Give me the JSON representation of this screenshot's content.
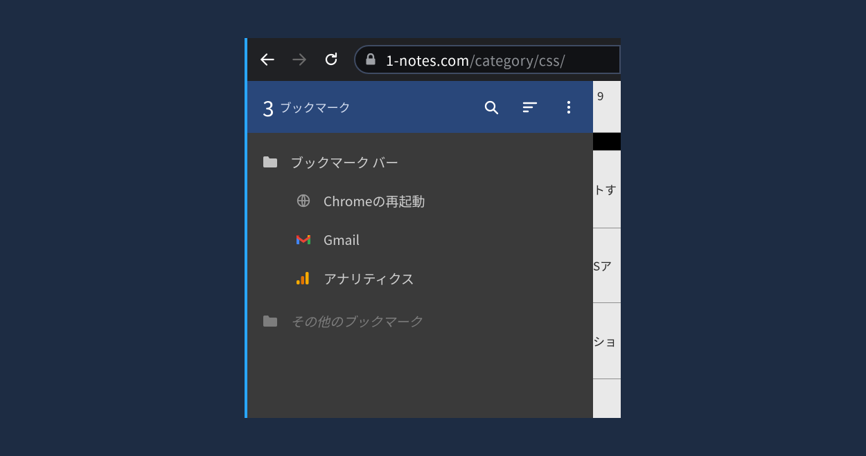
{
  "browser": {
    "url_host": "1-notes.com",
    "url_path": "/category/css/"
  },
  "bookmarkHeader": {
    "count": "3",
    "title": "ブックマーク"
  },
  "bookmarks": {
    "bar_label": "ブックマーク バー",
    "items": [
      {
        "label": "Chromeの再起動",
        "icon": "globe-icon"
      },
      {
        "label": "Gmail",
        "icon": "gmail-icon"
      },
      {
        "label": "アナリティクス",
        "icon": "analytics-icon"
      }
    ],
    "other_label": "その他のブックマーク"
  },
  "rightStrip": {
    "cell0": "9",
    "cell1": "トす",
    "cell2": "Sア",
    "cell3": "ショ"
  }
}
